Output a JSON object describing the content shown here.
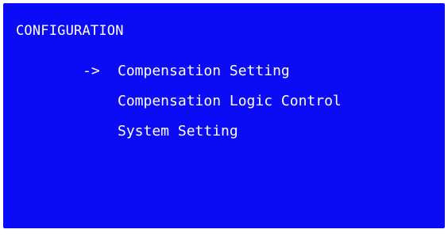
{
  "title": "CONFIGURATION",
  "menu": {
    "cursor": "->",
    "items": [
      {
        "label": "Compensation Setting",
        "selected": true
      },
      {
        "label": "Compensation Logic Control",
        "selected": false
      },
      {
        "label": "System Setting",
        "selected": false
      }
    ]
  },
  "colors": {
    "background": "#0b0bf5",
    "text": "#ffffff"
  }
}
